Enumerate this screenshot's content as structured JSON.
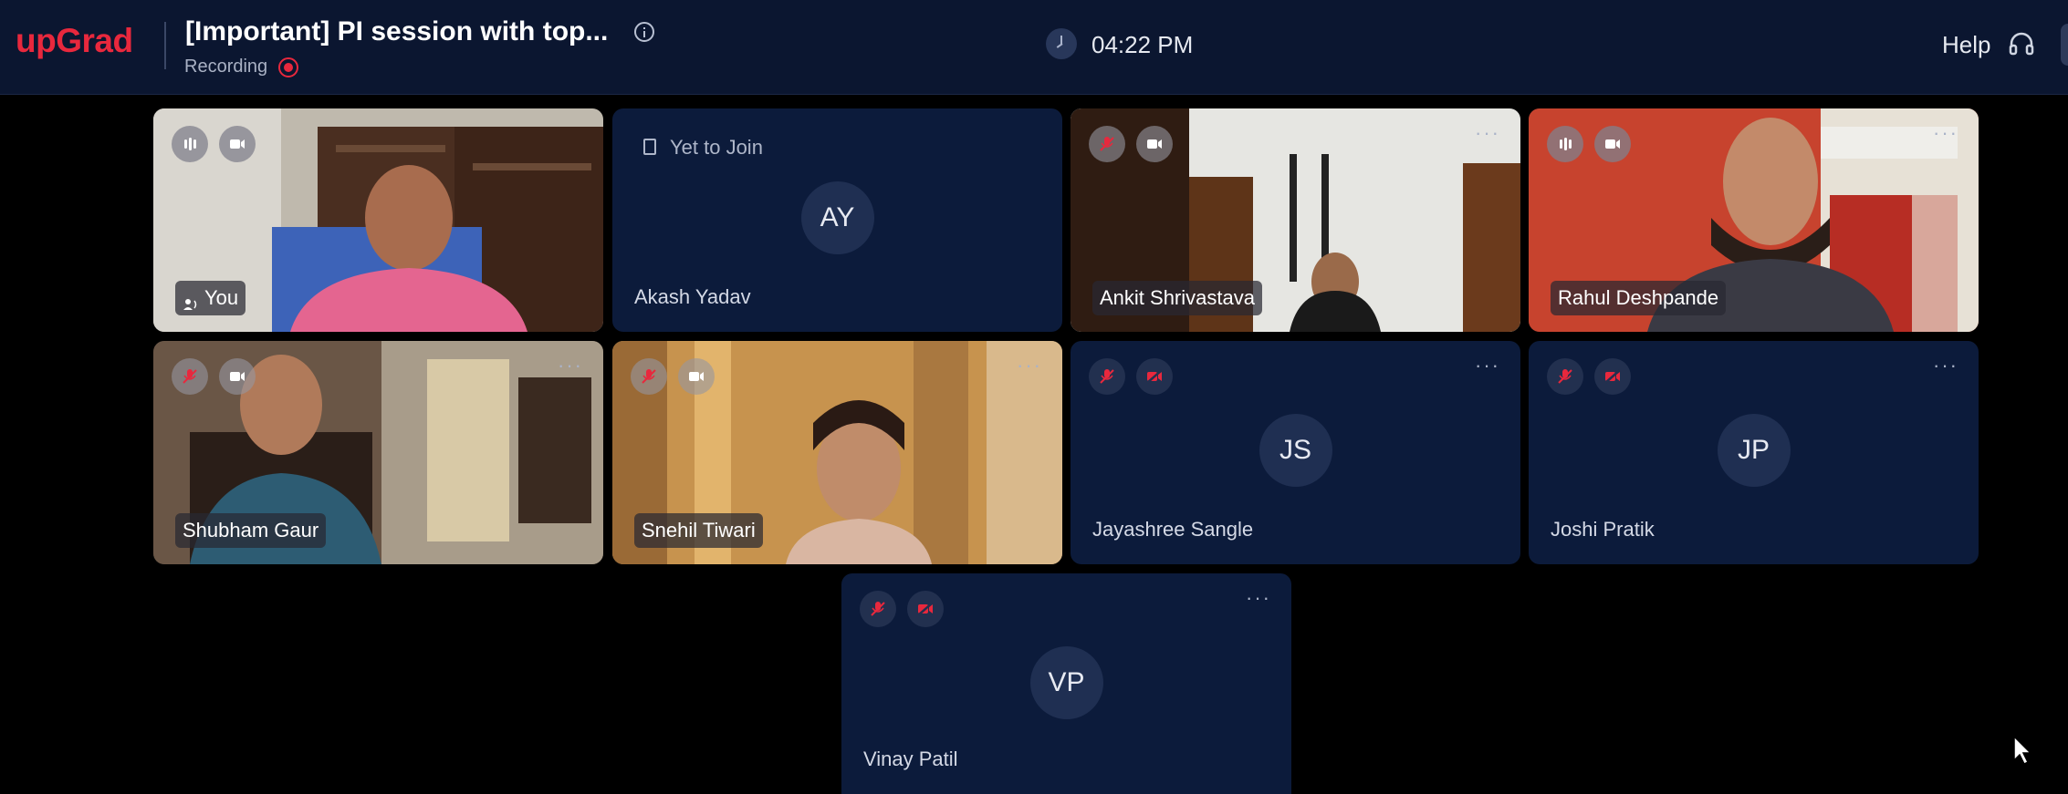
{
  "header": {
    "logo": "upGrad",
    "title": "[Important] PI session with top...",
    "recording_label": "Recording",
    "time": "04:22 PM",
    "help_label": "Help"
  },
  "tiles": {
    "you": {
      "name": "You"
    },
    "akash": {
      "status": "Yet to Join",
      "initials": "AY",
      "name": "Akash Yadav"
    },
    "ankit": {
      "name": "Ankit Shrivastava"
    },
    "rahul": {
      "name": "Rahul Deshpande"
    },
    "shubham": {
      "name": "Shubham Gaur"
    },
    "snehil": {
      "name": "Snehil Tiwari"
    },
    "jayashree": {
      "initials": "JS",
      "name": "Jayashree Sangle"
    },
    "joshi": {
      "initials": "JP",
      "name": "Joshi Pratik"
    },
    "vinay": {
      "initials": "VP",
      "name": "Vinay Patil"
    }
  },
  "colors": {
    "brand": "#e8283d",
    "background": "#0b1630",
    "tile": "#0c1b3b"
  }
}
